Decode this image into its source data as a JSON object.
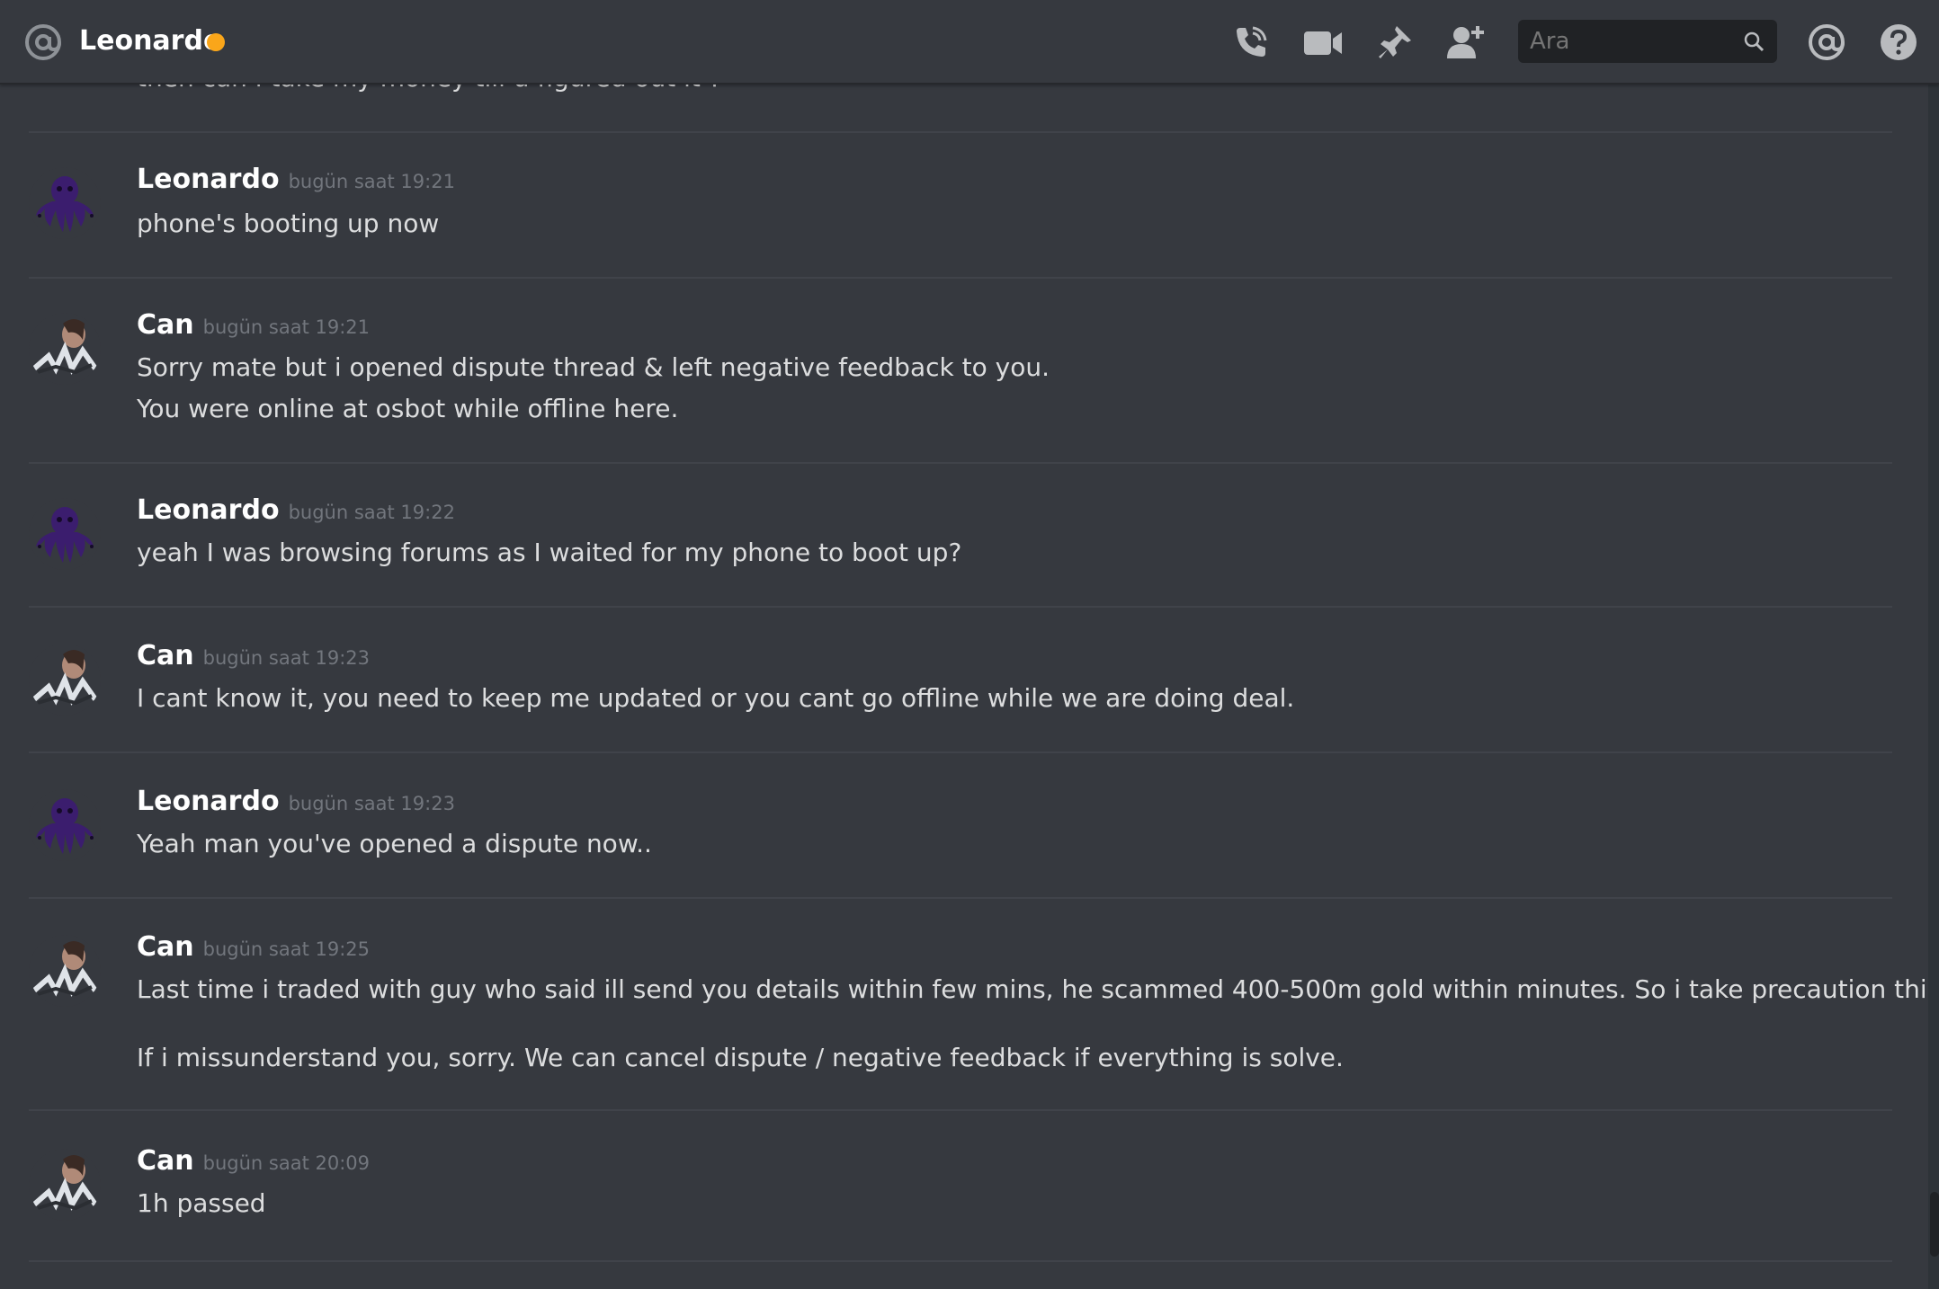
{
  "header": {
    "channel_name": "Leonardo",
    "status_color": "#faa61a",
    "search_placeholder": "Ara",
    "icons": [
      "at-icon",
      "phone-call-icon",
      "video-camera-icon",
      "pin-icon",
      "add-friend-icon",
      "search-icon",
      "mentions-icon",
      "help-icon"
    ]
  },
  "partial_message": "then can i take my money till u figured out it ?",
  "messages": [
    {
      "author": "Leonardo",
      "time": "bugün saat 19:21",
      "lines": [
        "phone's booting up now"
      ]
    },
    {
      "author": "Can",
      "time": "bugün saat 19:21",
      "lines": [
        "Sorry mate but i opened dispute thread & left negative feedback to you.",
        "You were online at osbot while offline here."
      ]
    },
    {
      "author": "Leonardo",
      "time": "bugün saat 19:22",
      "lines": [
        "yeah I was browsing forums as I waited for my phone to boot up?"
      ]
    },
    {
      "author": "Can",
      "time": "bugün saat 19:23",
      "lines": [
        "I cant know it, you need to keep me updated or you cant go offline while we are doing deal."
      ]
    },
    {
      "author": "Leonardo",
      "time": "bugün saat 19:23",
      "lines": [
        "Yeah man you've opened a dispute now.."
      ]
    },
    {
      "author": "Can",
      "time": "bugün saat 19:25",
      "lines": [
        "Last time i traded with guy who said ill send you details within few mins, he scammed 400-500m gold within minutes. So i take precaution this time.",
        "",
        "If i missunderstand you, sorry. We can cancel dispute / negative feedback if everything is solve."
      ]
    },
    {
      "author": "Can",
      "time": "bugün saat 20:09",
      "lines": [
        "1h passed"
      ]
    }
  ],
  "colors": {
    "background": "#36393f",
    "username": "#ffffff",
    "text": "#dcddde",
    "timestamp": "#72767d",
    "leonardo_avatar": "#3a1a6e",
    "divider": "#40434a"
  }
}
